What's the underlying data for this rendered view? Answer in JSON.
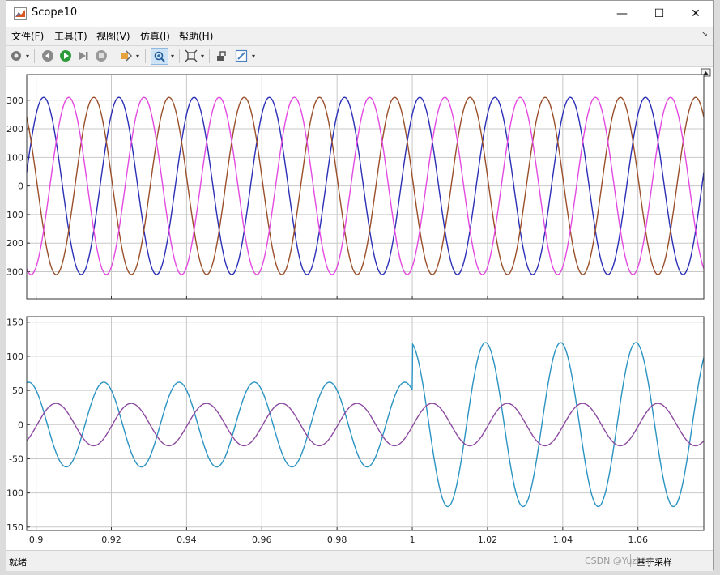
{
  "window": {
    "title": "Scope10",
    "minimize_glyph": "—",
    "maximize_glyph": "☐",
    "close_glyph": "✕"
  },
  "menu": {
    "items": [
      "文件(F)",
      "工具(T)",
      "视图(V)",
      "仿真(I)",
      "帮助(H)"
    ],
    "overflow_glyph": "↘"
  },
  "toolbar": {
    "icons": [
      "gear-icon",
      "step-back-icon",
      "run-icon",
      "step-forward-icon",
      "stop-icon",
      "highlight-icon",
      "zoom-in-icon",
      "autoscale-icon",
      "restore-icon",
      "style-icon"
    ]
  },
  "status": {
    "left": "就绪",
    "right": "基于采样",
    "watermark": "CSDN @Yuzi_hi"
  },
  "colors": {
    "plot_bg": "#ffffff",
    "grid": "#c8c8c8",
    "phase_a": "#2b2fb6",
    "phase_b": "#9a4f2a",
    "phase_c": "#e34ae0",
    "lower_a": "#2a93c1",
    "lower_b": "#8c4aa0"
  },
  "chart_data": [
    {
      "type": "line",
      "x_range": [
        0.8975,
        1.0775
      ],
      "ylim": [
        -395,
        390
      ],
      "yticks": [
        -300,
        -200,
        -100,
        0,
        100,
        200,
        300
      ],
      "grid": true,
      "series": [
        {
          "color": "#2b2fb6",
          "amplitude": 310,
          "frequency": 50,
          "phase_deg": 54
        },
        {
          "color": "#9a4f2a",
          "amplitude": 310,
          "frequency": 50,
          "phase_deg": 174
        },
        {
          "color": "#e34ae0",
          "amplitude": 310,
          "frequency": 50,
          "phase_deg": -66
        }
      ]
    },
    {
      "type": "line",
      "x_range": [
        0.8975,
        1.0775
      ],
      "xticks": [
        0.9,
        0.92,
        0.94,
        0.96,
        0.98,
        1,
        1.02,
        1.04,
        1.06
      ],
      "xtick_labels": [
        "0.9",
        "0.92",
        "0.94",
        "0.96",
        "0.98",
        "1",
        "1.02",
        "1.04",
        "1.06"
      ],
      "ylim": [
        -155,
        158
      ],
      "yticks": [
        -150,
        -100,
        -50,
        0,
        50,
        100,
        150
      ],
      "grid": true,
      "step_time": 1.0,
      "series": [
        {
          "color": "#2a93c1",
          "amplitude_before": 62,
          "amplitude_after": 120,
          "frequency": 50,
          "phase_before_deg": 126,
          "phase_after_deg": 100
        },
        {
          "color": "#8c4aa0",
          "amplitude": 31,
          "frequency": 50,
          "phase_deg": -5
        }
      ]
    }
  ]
}
